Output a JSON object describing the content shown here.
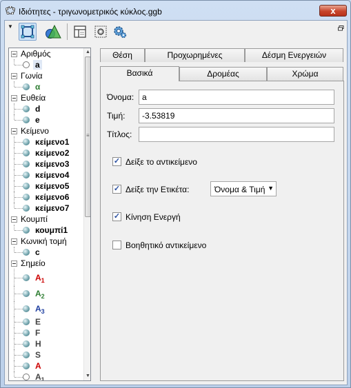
{
  "window": {
    "title": "Ιδιότητες - τριγωνομετρικός κύκλος.ggb",
    "close_glyph": "x"
  },
  "toolbar": {
    "menu_icon": "menu-arrow-icon",
    "buttons": [
      {
        "icon": "graphics-view-icon",
        "active": true
      },
      {
        "icon": "shapes-view-icon",
        "active": false
      },
      {
        "icon": "layout-icon",
        "active": false
      },
      {
        "icon": "object-settings-icon",
        "active": false
      },
      {
        "icon": "preferences-gear-icon",
        "active": false
      }
    ]
  },
  "tree": {
    "categories": [
      {
        "label": "Αριθμός",
        "items": [
          {
            "label": "a",
            "sub": "",
            "bullet": "hollow",
            "selected": true,
            "color": "#000000"
          }
        ]
      },
      {
        "label": "Γωνία",
        "items": [
          {
            "label": "α",
            "sub": "",
            "bullet": "filled",
            "selected": false,
            "color": "#2e7d32"
          }
        ]
      },
      {
        "label": "Ευθεία",
        "items": [
          {
            "label": "d",
            "sub": "",
            "bullet": "filled",
            "selected": false,
            "color": "#000000"
          },
          {
            "label": "e",
            "sub": "",
            "bullet": "filled",
            "selected": false,
            "color": "#000000"
          }
        ]
      },
      {
        "label": "Κείμενο",
        "items": [
          {
            "label": "κείμενο1",
            "sub": "",
            "bullet": "filled",
            "selected": false,
            "color": "#000000"
          },
          {
            "label": "κείμενο2",
            "sub": "",
            "bullet": "filled",
            "selected": false,
            "color": "#000000"
          },
          {
            "label": "κείμενο3",
            "sub": "",
            "bullet": "filled",
            "selected": false,
            "color": "#000000"
          },
          {
            "label": "κείμενο4",
            "sub": "",
            "bullet": "filled",
            "selected": false,
            "color": "#000000"
          },
          {
            "label": "κείμενο5",
            "sub": "",
            "bullet": "filled",
            "selected": false,
            "color": "#000000"
          },
          {
            "label": "κείμενο6",
            "sub": "",
            "bullet": "filled",
            "selected": false,
            "color": "#000000"
          },
          {
            "label": "κείμενο7",
            "sub": "",
            "bullet": "filled",
            "selected": false,
            "color": "#000000"
          }
        ]
      },
      {
        "label": "Κουμπί",
        "items": [
          {
            "label": "κουμπί1",
            "sub": "",
            "bullet": "filled",
            "selected": false,
            "color": "#000000"
          }
        ]
      },
      {
        "label": "Κωνική τομή",
        "items": [
          {
            "label": "c",
            "sub": "",
            "bullet": "filled",
            "selected": false,
            "color": "#000000"
          }
        ]
      },
      {
        "label": "Σημείο",
        "items": [
          {
            "label": "A",
            "sub": "1",
            "bullet": "filled",
            "selected": false,
            "color": "#cc0000",
            "tall": true
          },
          {
            "label": "A",
            "sub": "2",
            "bullet": "filled",
            "selected": false,
            "color": "#2e7d32",
            "tall": true
          },
          {
            "label": "A",
            "sub": "3",
            "bullet": "filled",
            "selected": false,
            "color": "#1f3fa0",
            "tall": true
          },
          {
            "label": "E",
            "sub": "",
            "bullet": "filled",
            "selected": false,
            "color": "#444444"
          },
          {
            "label": "F",
            "sub": "",
            "bullet": "filled",
            "selected": false,
            "color": "#444444"
          },
          {
            "label": "H",
            "sub": "",
            "bullet": "filled",
            "selected": false,
            "color": "#444444"
          },
          {
            "label": "S",
            "sub": "",
            "bullet": "filled",
            "selected": false,
            "color": "#444444"
          },
          {
            "label": "A",
            "sub": "",
            "bullet": "filled",
            "selected": false,
            "color": "#cc0000"
          },
          {
            "label": "A",
            "sub": "1",
            "bullet": "hollow",
            "selected": false,
            "color": "#444444"
          }
        ]
      }
    ]
  },
  "tabs": {
    "row_back": [
      {
        "label": "Θέση"
      },
      {
        "label": "Προχωρημένες"
      },
      {
        "label": "Δέσμη Ενεργειών"
      }
    ],
    "row_front": [
      {
        "label": "Βασικά",
        "active": true
      },
      {
        "label": "Δρομέας",
        "active": false
      },
      {
        "label": "Χρώμα",
        "active": false
      }
    ]
  },
  "basic": {
    "name_label": "Όνομα:",
    "name_value": "a",
    "value_label": "Τιμή:",
    "value_value": "-3.53819",
    "caption_label": "Τίτλος:",
    "caption_value": "",
    "show_object_label": "Δείξε το αντικείμενο",
    "show_object_checked": true,
    "show_label_label": "Δείξε την Ετικέτα:",
    "show_label_checked": true,
    "label_mode_value": "Όνομα & Τιμή",
    "animation_label": "Κίνηση Ενεργή",
    "animation_checked": true,
    "auxiliary_label": "Βοηθητικό αντικείμενο",
    "auxiliary_checked": false,
    "check_glyph": "✓"
  }
}
